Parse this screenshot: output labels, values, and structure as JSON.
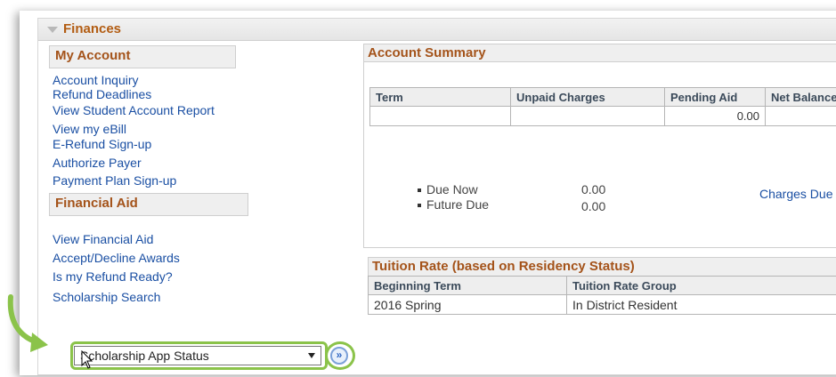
{
  "finances": {
    "title": "Finances"
  },
  "my_account": {
    "title": "My Account",
    "links": [
      "Account Inquiry",
      "Refund Deadlines",
      "View Student Account Report",
      "View my eBill",
      "E-Refund Sign-up",
      "Authorize Payer",
      "Payment Plan Sign-up"
    ]
  },
  "financial_aid": {
    "title": "Financial Aid",
    "links": [
      "View Financial Aid",
      "Accept/Decline Awards",
      "Is my Refund Ready?",
      "Scholarship Search"
    ]
  },
  "dropdown": {
    "selected": "Scholarship App Status",
    "go_icon": "double-chevron-right-icon"
  },
  "account_summary": {
    "title": "Account Summary",
    "columns": [
      "Term",
      "Unpaid Charges",
      "Pending Aid",
      "Net Balance"
    ],
    "row": [
      "",
      "",
      "0.00",
      ""
    ],
    "due": [
      {
        "label": "Due Now",
        "value": "0.00"
      },
      {
        "label": "Future Due",
        "value": "0.00"
      }
    ],
    "charges_link": "Charges Due"
  },
  "tuition_rate": {
    "title": "Tuition Rate (based on Residency Status)",
    "columns": [
      "Beginning Term",
      "Tuition Rate Group"
    ],
    "row": [
      "2016 Spring",
      "In District Resident"
    ]
  },
  "colors": {
    "accent_green": "#8bc34a",
    "heading_orange": "#a4531a",
    "link_blue": "#1a4fa3"
  }
}
